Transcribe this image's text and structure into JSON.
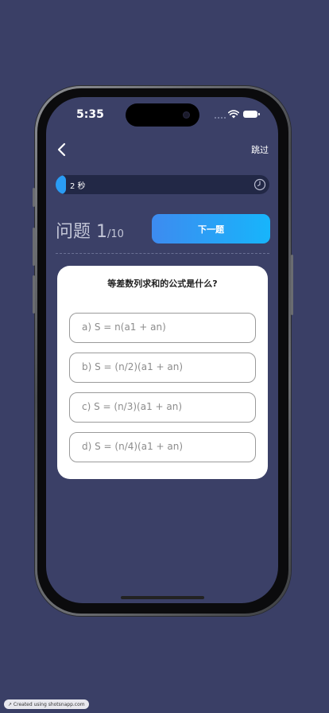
{
  "status_bar": {
    "time": "5:35"
  },
  "header": {
    "skip_label": "跳过"
  },
  "timer": {
    "text": "2 秒",
    "progress_percent": 5
  },
  "question": {
    "title": "问题",
    "number": "1",
    "total": "/10",
    "text": "等差数列求和的公式是什么?"
  },
  "next_button": {
    "label": "下一题"
  },
  "options": [
    {
      "label": "a) S = n(a1 + an)"
    },
    {
      "label": "b) S = (n/2)(a1 + an)"
    },
    {
      "label": "c) S = (n/3)(a1 + an)"
    },
    {
      "label": "d) S = (n/4)(a1 + an)"
    }
  ],
  "footer": {
    "credit": "↗ Created using shotsnapp.com"
  },
  "colors": {
    "background": "#3a3f66",
    "accent_start": "#3d8bf0",
    "accent_end": "#17b5fb",
    "timer_track": "#222846",
    "timer_fill": "#2a9cf4",
    "card": "#ffffff"
  }
}
